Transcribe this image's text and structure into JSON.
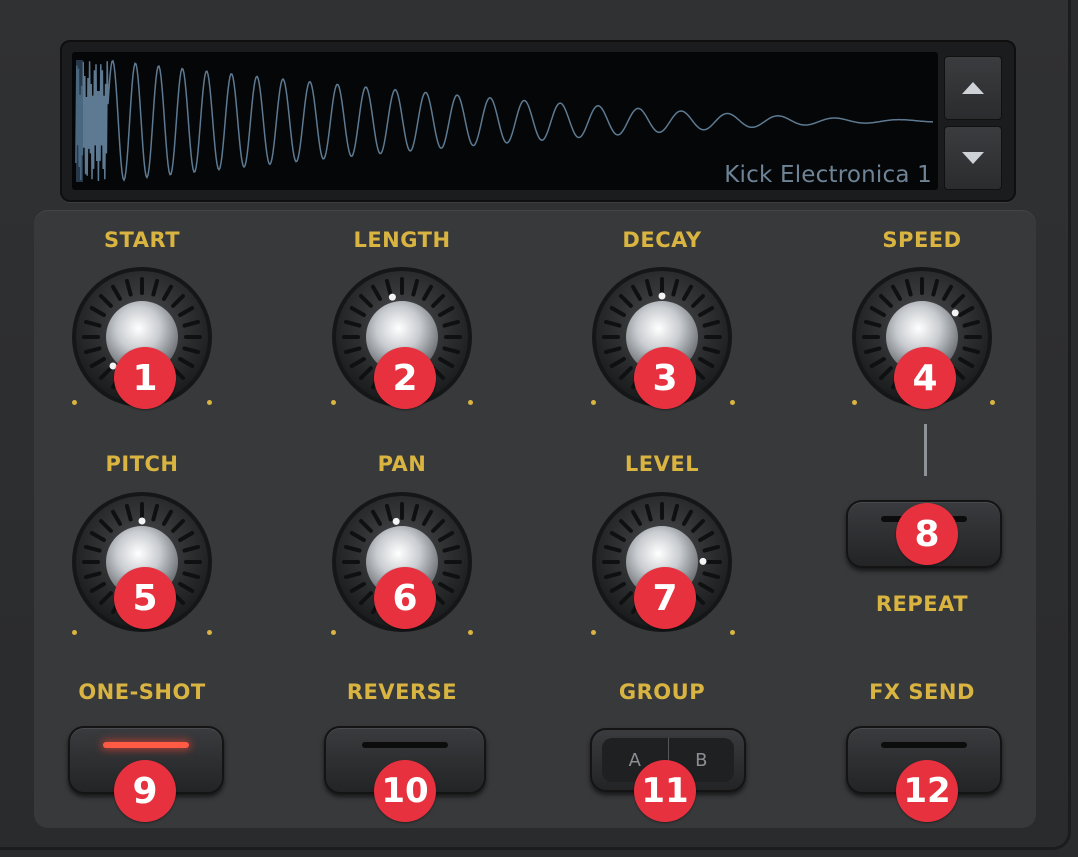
{
  "display": {
    "sample_name": "Kick Electronica 1",
    "up_icon": "triangle-up-icon",
    "down_icon": "triangle-down-icon"
  },
  "knobs": [
    {
      "id": "start",
      "label": "START",
      "badge": "1",
      "value": 0.0
    },
    {
      "id": "length",
      "label": "LENGTH",
      "badge": "2",
      "value": 0.45
    },
    {
      "id": "decay",
      "label": "DECAY",
      "badge": "3",
      "value": 0.5
    },
    {
      "id": "speed",
      "label": "SPEED",
      "badge": "4",
      "value": 0.7
    },
    {
      "id": "pitch",
      "label": "PITCH",
      "badge": "5",
      "value": 0.5
    },
    {
      "id": "pan",
      "label": "PAN",
      "badge": "6",
      "value": 0.47
    },
    {
      "id": "level",
      "label": "LEVEL",
      "badge": "7",
      "value": 0.83
    }
  ],
  "repeat": {
    "label": "REPEAT",
    "badge": "8",
    "on": false
  },
  "buttons": [
    {
      "id": "one-shot",
      "label": "ONE-SHOT",
      "badge": "9",
      "on": true
    },
    {
      "id": "reverse",
      "label": "REVERSE",
      "badge": "10",
      "on": false
    },
    {
      "id": "fx-send",
      "label": "FX SEND",
      "badge": "12",
      "on": false
    }
  ],
  "group": {
    "label": "GROUP",
    "badge": "11",
    "option_a": "A",
    "option_b": "B"
  },
  "colors": {
    "accent": "#d9b441",
    "badge": "#e8313e",
    "waveform": "#5d7a92",
    "led_on": "#ff5a43"
  }
}
